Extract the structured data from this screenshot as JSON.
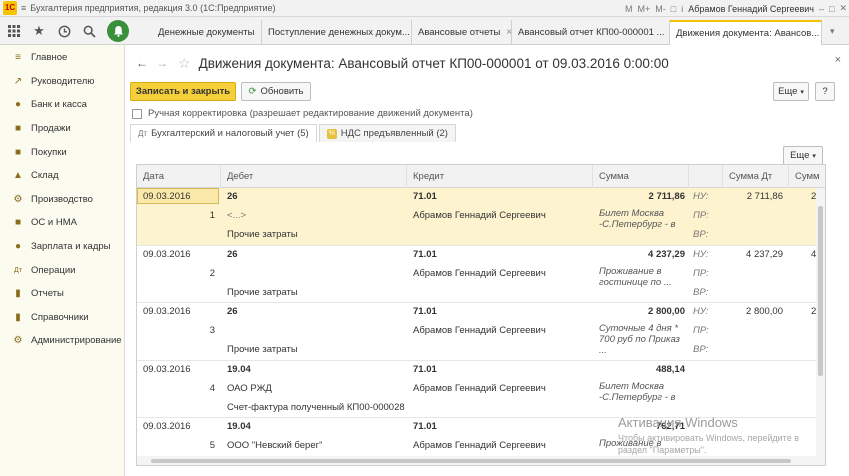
{
  "titlebar": {
    "logo_text": "1С",
    "menu_glyph": "≡",
    "title": "Бухгалтерия предприятия, редакция 3.0  (1С:Предприятие)",
    "user": "Абрамов Геннадий Сергеевич",
    "controls": [
      "M",
      "M+",
      "M-",
      "□",
      "i",
      "–",
      "□",
      "✕"
    ]
  },
  "toolbar": {
    "icons": [
      "apps-grid-icon",
      "star-icon",
      "history-icon",
      "search-icon",
      "bell-icon"
    ]
  },
  "tabs": [
    {
      "label": "Денежные документы"
    },
    {
      "label": "Поступление денежных докум..."
    },
    {
      "label": "Авансовые отчеты"
    },
    {
      "label": "Авансовый отчет КП00-000001 ..."
    },
    {
      "label": "Движения документа: Авансов..."
    }
  ],
  "sidebar": {
    "items": [
      {
        "label": "Главное",
        "icon": "≡"
      },
      {
        "label": "Руководителю",
        "icon": "↗"
      },
      {
        "label": "Банк и касса",
        "icon": "●"
      },
      {
        "label": "Продажи",
        "icon": "■"
      },
      {
        "label": "Покупки",
        "icon": "■"
      },
      {
        "label": "Склад",
        "icon": "▲"
      },
      {
        "label": "Производство",
        "icon": "⚙"
      },
      {
        "label": "ОС и НМА",
        "icon": "■"
      },
      {
        "label": "Зарплата и кадры",
        "icon": "●"
      },
      {
        "label": "Операции",
        "icon": "Дт"
      },
      {
        "label": "Отчеты",
        "icon": "▮"
      },
      {
        "label": "Справочники",
        "icon": "▮"
      },
      {
        "label": "Администрирование",
        "icon": "⚙"
      }
    ]
  },
  "header": {
    "title": "Движения документа: Авансовый отчет КП00-000001 от 09.03.2016 0:00:00",
    "close": "×",
    "back": "←",
    "forward": "→",
    "star": "☆"
  },
  "buttons": {
    "save_close": "Записать и закрыть",
    "refresh": "Обновить",
    "more": "Еще",
    "help": "?",
    "table_more": "Еще"
  },
  "checkbox": {
    "label": "Ручная корректировка (разрешает редактирование движений документа)"
  },
  "subtabs": [
    {
      "label": "Бухгалтерский и налоговый учет (5)",
      "icon": "Дт"
    },
    {
      "label": "НДС предъявленный (2)",
      "icon": "%"
    }
  ],
  "table": {
    "columns": [
      "Дата",
      "Дебет",
      "Кредит",
      "Сумма",
      "",
      "Сумма Дт",
      "Сумм"
    ],
    "rows": [
      {
        "date": "09.03.2016",
        "num": "1",
        "debit": "26",
        "debit_sub1": "<...>",
        "debit_sub2": "Прочие затраты",
        "credit": "71.01",
        "credit_sub": "Абрамов Геннадий Сергеевич",
        "amount": "2 711,86",
        "content": "Билет Москва -С.Петербург - в",
        "nu": "НУ:",
        "pr": "ПР:",
        "vr": "ВР:",
        "sum_dt": "2 711,86",
        "sum_last": "2"
      },
      {
        "date": "09.03.2016",
        "num": "2",
        "debit": "26",
        "debit_sub1": "",
        "debit_sub2": "Прочие затраты",
        "credit": "71.01",
        "credit_sub": "Абрамов Геннадий Сергеевич",
        "amount": "4 237,29",
        "content": "Проживание в гостинице  по ...",
        "nu": "НУ:",
        "pr": "ПР:",
        "vr": "ВР:",
        "sum_dt": "4 237,29",
        "sum_last": "4"
      },
      {
        "date": "09.03.2016",
        "num": "3",
        "debit": "26",
        "debit_sub1": "",
        "debit_sub2": "Прочие затраты",
        "credit": "71.01",
        "credit_sub": "Абрамов Геннадий Сергеевич",
        "amount": "2 800,00",
        "content": "Суточные 4 дня * 700 руб по Приказ ...",
        "nu": "НУ:",
        "pr": "ПР:",
        "vr": "ВР:",
        "sum_dt": "2 800,00",
        "sum_last": "2"
      },
      {
        "date": "09.03.2016",
        "num": "4",
        "debit": "19.04",
        "debit_sub1": "ОАО РЖД",
        "debit_sub2": "Счет-фактура полученный КП00-000028 ...",
        "credit": "71.01",
        "credit_sub": "Абрамов Геннадий Сергеевич",
        "amount": "488,14",
        "content": "Билет Москва -С.Петербург - в",
        "nu": "",
        "pr": "",
        "vr": "",
        "sum_dt": "",
        "sum_last": ""
      },
      {
        "date": "09.03.2016",
        "num": "5",
        "debit": "19.04",
        "debit_sub1": "ООО \"Невский берег\"",
        "debit_sub2": "",
        "credit": "71.01",
        "credit_sub": "Абрамов Геннадий Сергеевич",
        "amount": "762,71",
        "content": "Проживание в",
        "nu": "",
        "pr": "",
        "vr": "",
        "sum_dt": "",
        "sum_last": ""
      }
    ]
  },
  "watermark": {
    "line1": "Активация Windows",
    "line2": "Чтобы активировать Windows, перейдите в",
    "line3": "раздел \"Параметры\"."
  }
}
